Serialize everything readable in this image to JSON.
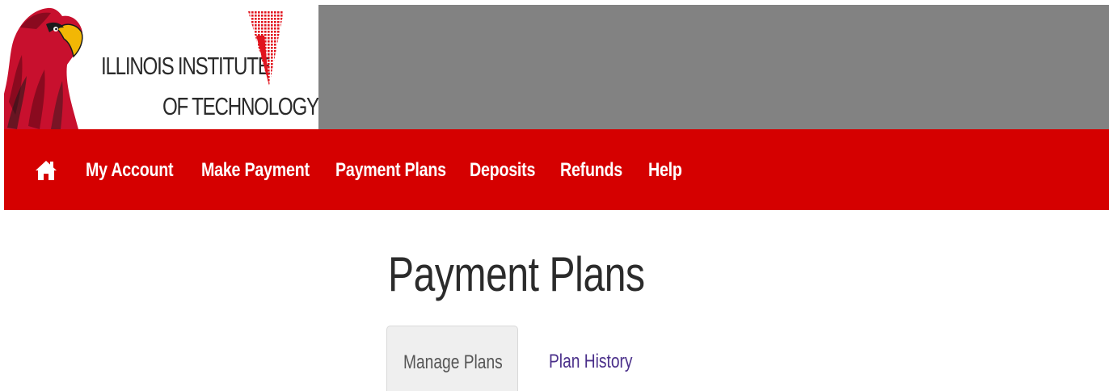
{
  "logo": {
    "line1": "ILLINOIS INSTITUTE",
    "line2": "OF TECHNOLOGY",
    "icon": "scarlet-hawk-mascot"
  },
  "nav": {
    "home_icon": "home-icon",
    "items": [
      {
        "label": "My Account"
      },
      {
        "label": "Make Payment"
      },
      {
        "label": "Payment Plans"
      },
      {
        "label": "Deposits"
      },
      {
        "label": "Refunds"
      },
      {
        "label": "Help"
      }
    ]
  },
  "page": {
    "title": "Payment Plans",
    "tabs": [
      {
        "label": "Manage Plans",
        "active": true
      },
      {
        "label": "Plan History",
        "active": false
      }
    ]
  },
  "colors": {
    "nav_background": "#d50000",
    "header_background": "#828282",
    "link_color": "#4a2f8a"
  }
}
